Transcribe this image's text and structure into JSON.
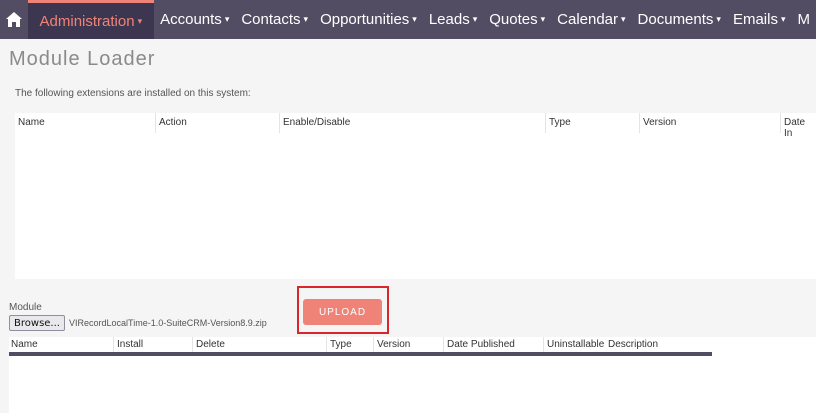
{
  "nav": {
    "items": [
      {
        "label": "Administration",
        "active": true
      },
      {
        "label": "Accounts"
      },
      {
        "label": "Contacts"
      },
      {
        "label": "Opportunities"
      },
      {
        "label": "Leads"
      },
      {
        "label": "Quotes"
      },
      {
        "label": "Calendar"
      },
      {
        "label": "Documents"
      },
      {
        "label": "Emails"
      },
      {
        "label": "M"
      }
    ],
    "caret": "▾"
  },
  "page": {
    "title": "Module Loader",
    "intro": "The following extensions are installed on this system:"
  },
  "installed_table": {
    "columns": [
      "Name",
      "Action",
      "Enable/Disable",
      "Type",
      "Version",
      "Date In"
    ]
  },
  "upload": {
    "module_label": "Module",
    "browse_label": "Browse...",
    "filename": "VIRecordLocalTime-1.0-SuiteCRM-Version8.9.zip",
    "upload_label": "UPLOAD"
  },
  "packages_table": {
    "columns": [
      "Name",
      "Install",
      "Delete",
      "Type",
      "Version",
      "Date Published",
      "Uninstallable",
      "Description"
    ]
  },
  "colors": {
    "nav_bg": "#534d64",
    "accent": "#f08377",
    "highlight_frame": "#d9262c"
  }
}
